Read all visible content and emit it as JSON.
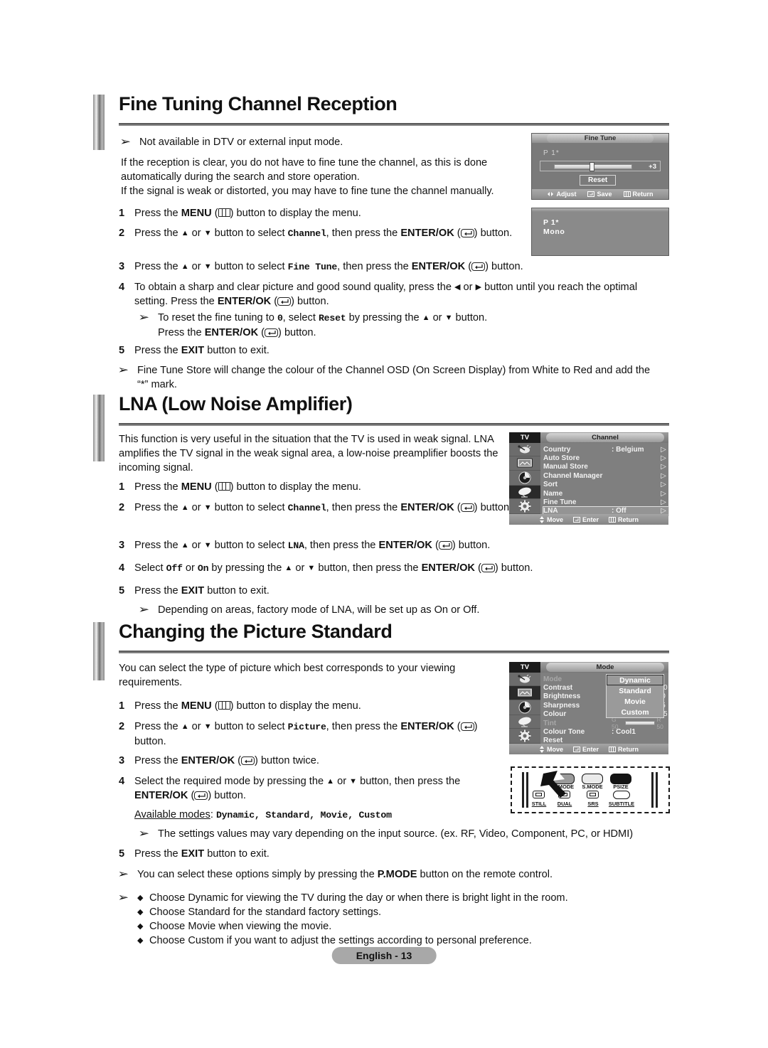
{
  "sections": [
    {
      "id": "fine-tuning",
      "title": "Fine Tuning Channel Reception",
      "notes_top": [
        "Not available in DTV or external input mode."
      ],
      "intro": [
        "If the reception is clear, you do not have to fine tune the channel, as this is done automatically during the search and store operation.",
        "If the signal is weak or distorted, you may have to fine tune the channel manually."
      ],
      "steps": [
        {
          "num": "1",
          "text_a": "Press the ",
          "bold_b": "MENU",
          "icon": "menu-icon",
          "text_c": ") button to display the menu."
        },
        {
          "num": "2",
          "text_a": "Press the ",
          "text_b": " or ",
          "text_c": " button to select ",
          "code": "Channel",
          "text_d": ", then press the ",
          "bold_e": "ENTER/OK",
          "text_f": ") button."
        },
        {
          "num": "3",
          "text_a": "Press the ",
          "text_c": " button to select ",
          "code": "Fine Tune",
          "text_d": ", then press the ",
          "bold_e": "ENTER/OK",
          "text_f": ") button."
        },
        {
          "num": "4",
          "text_a": "To obtain a sharp and clear picture and good sound quality, press the ",
          "text_c": " or ",
          "text_d": " button until you reach the optimal setting. Press the ",
          "bold_e": "ENTER/OK",
          "text_f": ") button."
        },
        {
          "num": "5",
          "text_a": "Press the ",
          "bold_b": "EXIT",
          "text_c": " button to exit."
        }
      ],
      "substep_note": {
        "a": "To reset the fine tuning to ",
        "code0": "0",
        "b": ", select ",
        "code1": "Reset",
        "c": " by pressing the ",
        "d": " or ",
        "e": " button.",
        "f": "Press the ",
        "bold_enter": "ENTER/OK",
        "g": ") button."
      },
      "notes_bottom": [
        "Fine Tune Store will change the colour of the Channel OSD (On Screen Display) from White to Red and add the “*” mark."
      ]
    },
    {
      "id": "lna",
      "title": "LNA (Low Noise Amplifier)",
      "intro": [
        "This function is very useful in the situation that the TV is used in weak signal. LNA amplifies the TV signal in the weak signal area, a low-noise preamplifier boosts the incoming signal."
      ],
      "steps": [
        {
          "num": "1",
          "text_a": "Press the ",
          "bold_b": "MENU",
          "text_c": ") button to display the menu."
        },
        {
          "num": "2",
          "text_a": "Press the ",
          "text_c": " button to select ",
          "code": "Channel",
          "text_d": ", then press the ",
          "bold_e": "ENTER/OK",
          "text_f": ") button."
        },
        {
          "num": "3",
          "text_a": "Press the ",
          "text_c": " button to select ",
          "code": "LNA",
          "text_d": ", then press the ",
          "bold_e": "ENTER/OK",
          "text_f": ") button."
        },
        {
          "num": "4",
          "text_a": "Select ",
          "code0": "Off",
          "text_b": " or ",
          "code1": "On",
          "text_c": " by pressing the ",
          "text_d": " button, then press the ",
          "bold_e": "ENTER/OK",
          "text_f": ") button."
        },
        {
          "num": "5",
          "text_a": "Press the ",
          "bold_b": "EXIT",
          "text_c": " button to exit."
        }
      ],
      "notes_bottom": [
        "Depending on areas, factory mode of LNA, will be set up as On or Off."
      ]
    },
    {
      "id": "picture-standard",
      "title": "Changing the Picture Standard",
      "intro": [
        "You can select the type of picture which best corresponds to your viewing requirements."
      ],
      "steps": [
        {
          "num": "1",
          "text_a": "Press the ",
          "bold_b": "MENU",
          "text_c": ") button to display the menu."
        },
        {
          "num": "2",
          "text_a": "Press the ",
          "text_c": " button to select ",
          "code": "Picture",
          "text_d": ", then press the ",
          "bold_e": "ENTER/OK",
          "text_f": ") button."
        },
        {
          "num": "3",
          "text_a": "Press the ",
          "bold_b": "ENTER/OK",
          "text_c": ") button twice."
        },
        {
          "num": "4",
          "text_a": "Select the required mode by pressing the ",
          "text_c": " button, then press the ",
          "bold_e": "ENTER/OK",
          "text_f": ") button."
        },
        {
          "num": "5",
          "text_a": "Press the ",
          "bold_b": "EXIT",
          "text_c": " button to exit."
        }
      ],
      "available_modes_label": "Available modes",
      "available_modes_value": "Dynamic, Standard, Movie, Custom",
      "notes": [
        "The settings values may vary depending on the input source. (ex. RF, Video, Component, PC, or HDMI)",
        "You can select these options simply by pressing the P.MODE button on the remote control."
      ],
      "pmode_note_a": "You can select these options simply by pressing the ",
      "pmode_bold": "P.MODE",
      "pmode_note_b": " button on the remote control.",
      "bullets": [
        "Choose Dynamic for viewing the TV during the day or when there is bright light in the room.",
        "Choose Standard for the standard factory settings.",
        "Choose Movie when viewing the movie.",
        "Choose Custom if you want to adjust the settings according to personal preference."
      ]
    }
  ],
  "osd_finetune": {
    "title": "Fine Tune",
    "channel_label": "P  1",
    "star": "*",
    "value": "+3",
    "reset_label": "Reset",
    "footer": [
      {
        "icon": "left-right-icon",
        "label": "Adjust"
      },
      {
        "icon": "enter-icon",
        "label": "Save"
      },
      {
        "icon": "menu-icon",
        "label": "Return"
      }
    ]
  },
  "osd_mono": {
    "channel_label": "P  1",
    "star": "*",
    "sound_mode": "Mono"
  },
  "menu_channel": {
    "source_label": "TV",
    "title": "Channel",
    "rows": [
      {
        "name": "Country",
        "value": ": Belgium",
        "arrow": "▷",
        "selected": false
      },
      {
        "name": "Auto Store",
        "value": "",
        "arrow": "▷",
        "selected": false
      },
      {
        "name": "Manual Store",
        "value": "",
        "arrow": "▷",
        "selected": false
      },
      {
        "name": "Channel Manager",
        "value": "",
        "arrow": "▷",
        "selected": false
      },
      {
        "name": "Sort",
        "value": "",
        "arrow": "▷",
        "selected": false
      },
      {
        "name": "Name",
        "value": "",
        "arrow": "▷",
        "selected": false
      },
      {
        "name": "Fine Tune",
        "value": "",
        "arrow": "▷",
        "selected": false
      },
      {
        "name": "LNA",
        "value": ": Off",
        "arrow": "▷",
        "selected": true
      }
    ],
    "footer": [
      {
        "icon": "up-down-icon",
        "label": "Move"
      },
      {
        "icon": "enter-icon",
        "label": "Enter"
      },
      {
        "icon": "menu-icon",
        "label": "Return"
      }
    ],
    "side_icons": [
      "antenna-icon",
      "picture-icon",
      "sound-icon",
      "satellite-icon",
      "setup-icon"
    ],
    "selected_side_icon_index": 3
  },
  "menu_mode": {
    "source_label": "TV",
    "title": "Mode",
    "rows": [
      {
        "name": "Mode",
        "value": ":",
        "dim": true
      },
      {
        "name": "Contrast",
        "value": "00",
        "bar": 38
      },
      {
        "name": "Brightness",
        "value": "0",
        "bar": 38
      },
      {
        "name": "Sharpness",
        "value": "5",
        "bar": 38
      },
      {
        "name": "Colour",
        "value": "55",
        "bar": 62
      },
      {
        "name": "Tint",
        "value": "",
        "dim": true,
        "tint_left": "G 50",
        "tint_right": "R 50"
      },
      {
        "name": "Colour Tone",
        "value": ": Cool1"
      },
      {
        "name": "Reset",
        "value": ""
      }
    ],
    "dropdown": [
      {
        "label": "Dynamic",
        "selected": true
      },
      {
        "label": "Standard",
        "selected": false
      },
      {
        "label": "Movie",
        "selected": false
      },
      {
        "label": "Custom",
        "selected": false
      }
    ],
    "footer": [
      {
        "icon": "up-down-icon",
        "label": "Move"
      },
      {
        "icon": "enter-icon",
        "label": "Enter"
      },
      {
        "icon": "menu-icon",
        "label": "Return"
      }
    ],
    "side_icons": [
      "antenna-icon",
      "picture-icon",
      "sound-icon",
      "satellite-icon",
      "setup-icon"
    ],
    "selected_side_icon_index": 1
  },
  "remote": {
    "top_buttons": [
      {
        "label": "P.MODE",
        "fill": "#9a9a9a"
      },
      {
        "label": "S.MODE",
        "fill": "#e8e8e8"
      },
      {
        "label": "PSIZE",
        "fill": "#1a1a1a"
      }
    ],
    "bottom_buttons": [
      {
        "label": "STILL"
      },
      {
        "label": "DUAL"
      },
      {
        "label": "SRS"
      },
      {
        "label": "SUBTITLE"
      }
    ]
  },
  "footer": {
    "page_label": "English - 13"
  },
  "colors": {
    "osd_bg": "#7a7a7a",
    "menu_bg": "#7f7f7f",
    "footer_pill": "#a8a8a8",
    "text": "#111111"
  }
}
